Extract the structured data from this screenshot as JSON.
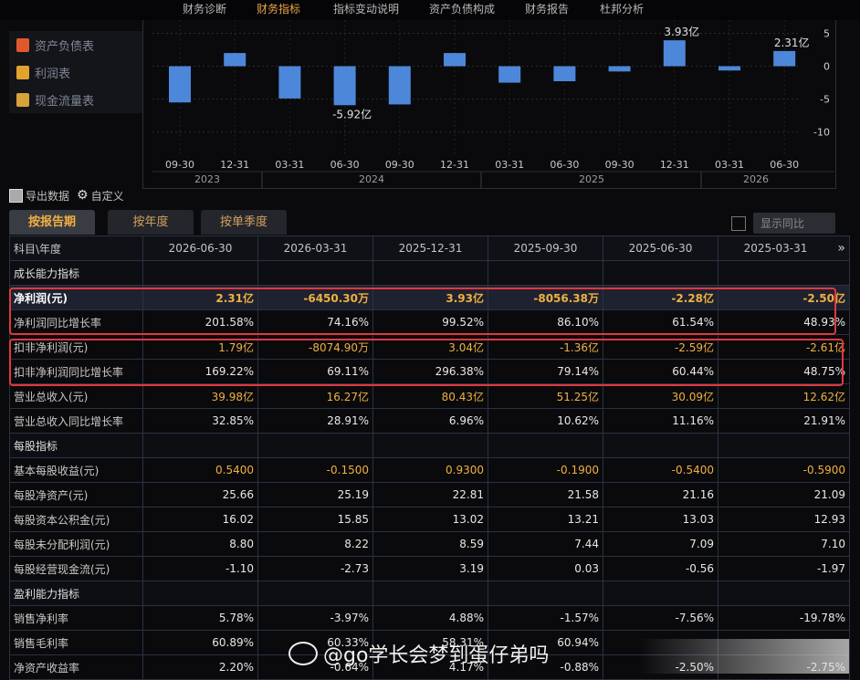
{
  "topnav": {
    "tabs": [
      {
        "label": "财务诊断"
      },
      {
        "label": "财务指标"
      },
      {
        "label": "指标变动说明"
      },
      {
        "label": "资产负债构成"
      },
      {
        "label": "财务报告"
      },
      {
        "label": "杜邦分析"
      }
    ],
    "active": "财务指标"
  },
  "sidebar": {
    "items": [
      {
        "label": "资产负债表",
        "icon": "balance-sheet-icon",
        "color": "#e2582e"
      },
      {
        "label": "利润表",
        "icon": "profit-icon",
        "color": "#e2a32e"
      },
      {
        "label": "现金流量表",
        "icon": "cashflow-icon",
        "color": "#d9a23a"
      }
    ]
  },
  "chart_data": {
    "type": "bar",
    "categories": [
      "09-30",
      "12-31",
      "03-31",
      "06-30",
      "09-30",
      "12-31",
      "03-31",
      "06-30",
      "09-30",
      "12-31",
      "03-31",
      "06-30"
    ],
    "year_labels": [
      "2023",
      "2024",
      "2025",
      "2026"
    ],
    "values": [
      -5.5,
      2.0,
      -4.9,
      -5.92,
      -5.8,
      2.0,
      -2.5,
      -2.28,
      -0.8,
      3.93,
      -0.65,
      2.31
    ],
    "unit": "亿",
    "annotations": [
      {
        "index": 3,
        "text": "-5.92亿"
      },
      {
        "index": 9,
        "text": "3.93亿"
      },
      {
        "index": 11,
        "text": "2.31亿"
      }
    ],
    "y_ticks": [
      "5",
      "0",
      "-5",
      "-10"
    ],
    "ylim": [
      -13.5,
      7
    ],
    "bar_color": "#4d87d9"
  },
  "toolbar": {
    "export_label": "导出数据",
    "custom_label": "自定义"
  },
  "subtabs": [
    {
      "label": "按报告期"
    },
    {
      "label": "按年度"
    },
    {
      "label": "按单季度"
    }
  ],
  "yoy_label": "显示同比",
  "table": {
    "header_label": "科目\\年度",
    "dates": [
      "2026-06-30",
      "2026-03-31",
      "2025-12-31",
      "2025-09-30",
      "2025-06-30",
      "2025-03-31"
    ],
    "rows": [
      {
        "label": "成长能力指标",
        "section": true,
        "values": [
          "",
          "",
          "",
          "",
          "",
          ""
        ]
      },
      {
        "label": "净利润(元)",
        "hl": true,
        "values": [
          "2.31亿",
          "-6450.30万",
          "3.93亿",
          "-8056.38万",
          "-2.28亿",
          "-2.50亿"
        ]
      },
      {
        "label": "净利润同比增长率",
        "values": [
          "201.58%",
          "74.16%",
          "99.52%",
          "86.10%",
          "61.54%",
          "48.93%"
        ]
      },
      {
        "label": "扣非净利润(元)",
        "orange": true,
        "values": [
          "1.79亿",
          "-8074.90万",
          "3.04亿",
          "-1.36亿",
          "-2.59亿",
          "-2.61亿"
        ]
      },
      {
        "label": "扣非净利润同比增长率",
        "values": [
          "169.22%",
          "69.11%",
          "296.38%",
          "79.14%",
          "60.44%",
          "48.75%"
        ]
      },
      {
        "label": "营业总收入(元)",
        "orange": true,
        "values": [
          "39.98亿",
          "16.27亿",
          "80.43亿",
          "51.25亿",
          "30.09亿",
          "12.62亿"
        ]
      },
      {
        "label": "营业总收入同比增长率",
        "values": [
          "32.85%",
          "28.91%",
          "6.96%",
          "10.62%",
          "11.16%",
          "21.91%"
        ]
      },
      {
        "label": "每股指标",
        "section": true,
        "values": [
          "",
          "",
          "",
          "",
          "",
          ""
        ]
      },
      {
        "label": "基本每股收益(元)",
        "orange": true,
        "values": [
          "0.5400",
          "-0.1500",
          "0.9300",
          "-0.1900",
          "-0.5400",
          "-0.5900"
        ]
      },
      {
        "label": "每股净资产(元)",
        "values": [
          "25.66",
          "25.19",
          "22.81",
          "21.58",
          "21.16",
          "21.09"
        ]
      },
      {
        "label": "每股资本公积金(元)",
        "values": [
          "16.02",
          "15.85",
          "13.02",
          "13.21",
          "13.03",
          "12.93"
        ]
      },
      {
        "label": "每股未分配利润(元)",
        "values": [
          "8.80",
          "8.22",
          "8.59",
          "7.44",
          "7.09",
          "7.10"
        ]
      },
      {
        "label": "每股经营现金流(元)",
        "values": [
          "-1.10",
          "-2.73",
          "3.19",
          "0.03",
          "-0.56",
          "-1.97"
        ]
      },
      {
        "label": "盈利能力指标",
        "section": true,
        "values": [
          "",
          "",
          "",
          "",
          "",
          ""
        ]
      },
      {
        "label": "销售净利率",
        "values": [
          "5.78%",
          "-3.97%",
          "4.88%",
          "-1.57%",
          "-7.56%",
          "-19.78%"
        ]
      },
      {
        "label": "销售毛利率",
        "values": [
          "60.89%",
          "60.33%",
          "58.31%",
          "60.94%",
          "",
          ""
        ]
      },
      {
        "label": "净资产收益率",
        "values": [
          "2.20%",
          "-0.64%",
          "4.17%",
          "-0.88%",
          "-2.50%",
          "-2.75%"
        ]
      }
    ]
  },
  "watermark": "@go学长会梦到蛋仔弟吗"
}
